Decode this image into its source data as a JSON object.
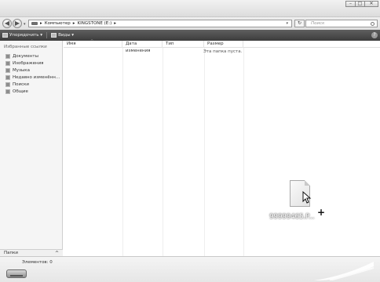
{
  "window": {
    "minimize_glyph": "–",
    "maximize_glyph": "□",
    "close_glyph": "✕"
  },
  "navigation": {
    "back_glyph": "◀",
    "forward_glyph": "▶",
    "dropdown_glyph": "▾",
    "breadcrumbs": [
      "▸",
      "Компьютер",
      "▸",
      "KINGSTONE (E:)",
      "▸"
    ],
    "address_dropdown_glyph": "▾",
    "refresh_glyph": "↻",
    "search_placeholder": "Поиск"
  },
  "commandbar": {
    "organize_label": "Упорядочить ▾",
    "views_label": "Виды ▾",
    "help_glyph": "?"
  },
  "navpane": {
    "favorites_header": "Избранные ссылки",
    "items": [
      {
        "label": "Документы",
        "icon": "documents-icon"
      },
      {
        "label": "Изображения",
        "icon": "pictures-icon"
      },
      {
        "label": "Музыка",
        "icon": "music-icon"
      },
      {
        "label": "Недавно изменённ...",
        "icon": "recent-icon"
      },
      {
        "label": "Поиски",
        "icon": "searches-icon"
      },
      {
        "label": "Общие",
        "icon": "public-icon"
      }
    ],
    "folders_label": "Папки",
    "folders_chevron": "^"
  },
  "content": {
    "columns": [
      "Имя",
      "Дата изменения",
      "Тип",
      "Размер"
    ],
    "empty_message": "Эта папка пуста.",
    "dragged_file_name": "99999465.P..."
  },
  "details": {
    "items_count": "Элементов: 0"
  }
}
